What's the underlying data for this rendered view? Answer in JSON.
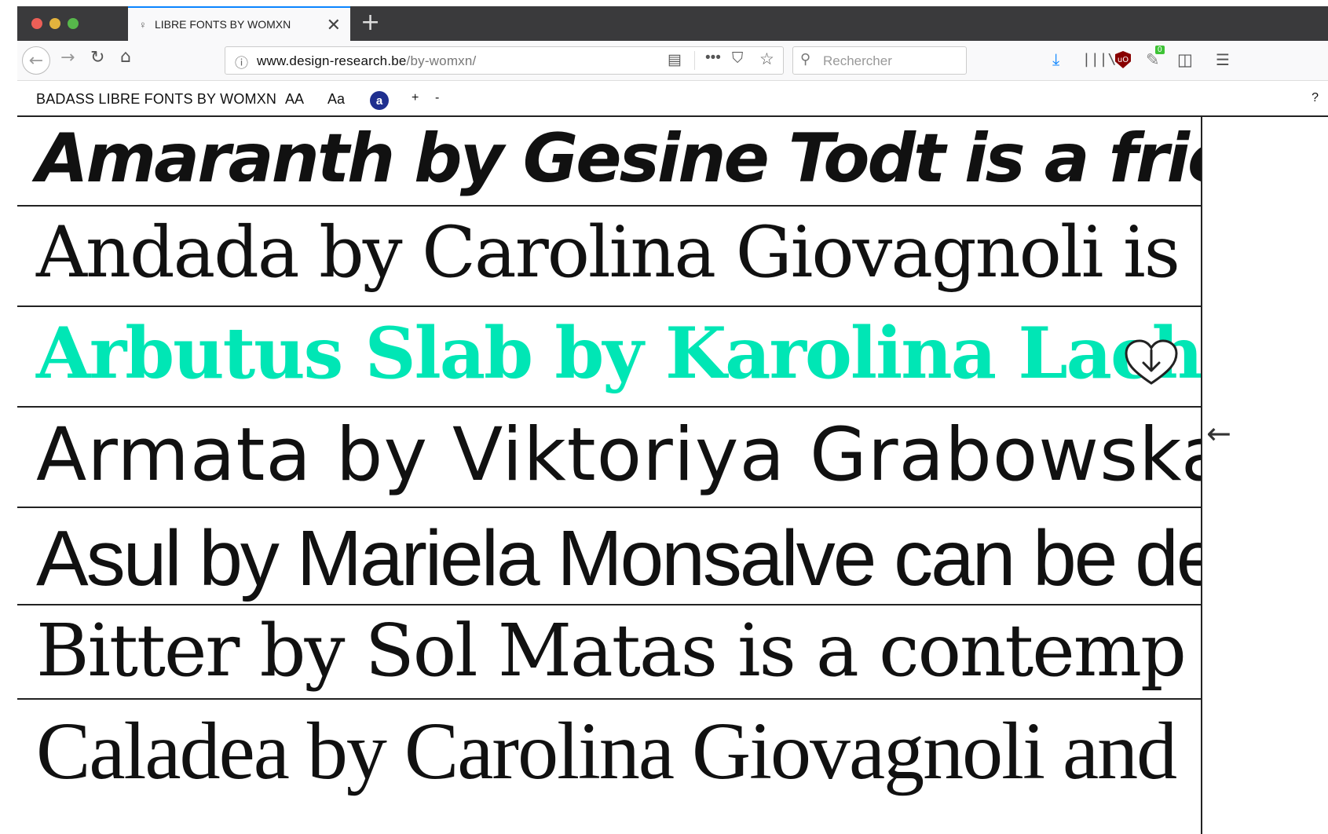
{
  "browser": {
    "tab": {
      "favicon": "♀",
      "title": "LIBRE FONTS BY WOMXN",
      "close": "✕"
    },
    "new_tab": "+",
    "url_domain": "www.design-research.be",
    "url_path": "/by-womxn/",
    "search_placeholder": "Rechercher",
    "extension_badge": "0",
    "icons": {
      "back": "arrow-left-icon",
      "forward": "arrow-right-icon",
      "reload": "reload-icon",
      "home": "home-icon",
      "info": "info-icon",
      "reader": "reader-view-icon",
      "more": "more-icon",
      "pocket": "pocket-icon",
      "bookmark": "star-icon",
      "search": "search-icon",
      "download": "download-icon",
      "library": "library-icon",
      "ublock": "ublock-icon",
      "sidebar": "sidebar-icon",
      "menu": "hamburger-menu-icon"
    }
  },
  "site": {
    "title": "BADASS LIBRE FONTS BY WOMXN",
    "caps_toggle": "AA",
    "case_toggle": "Aa",
    "a_badge": "a",
    "plus": "+",
    "minus": "-",
    "help": "?"
  },
  "fonts": [
    {
      "text": "Amaranth by Gesine Todt is a friendly"
    },
    {
      "text": "Andada by Carolina Giovagnoli is a"
    },
    {
      "text": "Arbutus Slab by Karolina Lach"
    },
    {
      "text": "Armata by Viktoriya Grabowska"
    },
    {
      "text": "Asul by Mariela Monsalve can be de"
    },
    {
      "text": "Bitter by Sol Matas is a contemp"
    },
    {
      "text": "Caladea by Carolina Giovagnoli and"
    }
  ],
  "colors": {
    "highlight": "#00e6b5",
    "text": "#111111",
    "accent_badge": "#1f2f8f"
  }
}
